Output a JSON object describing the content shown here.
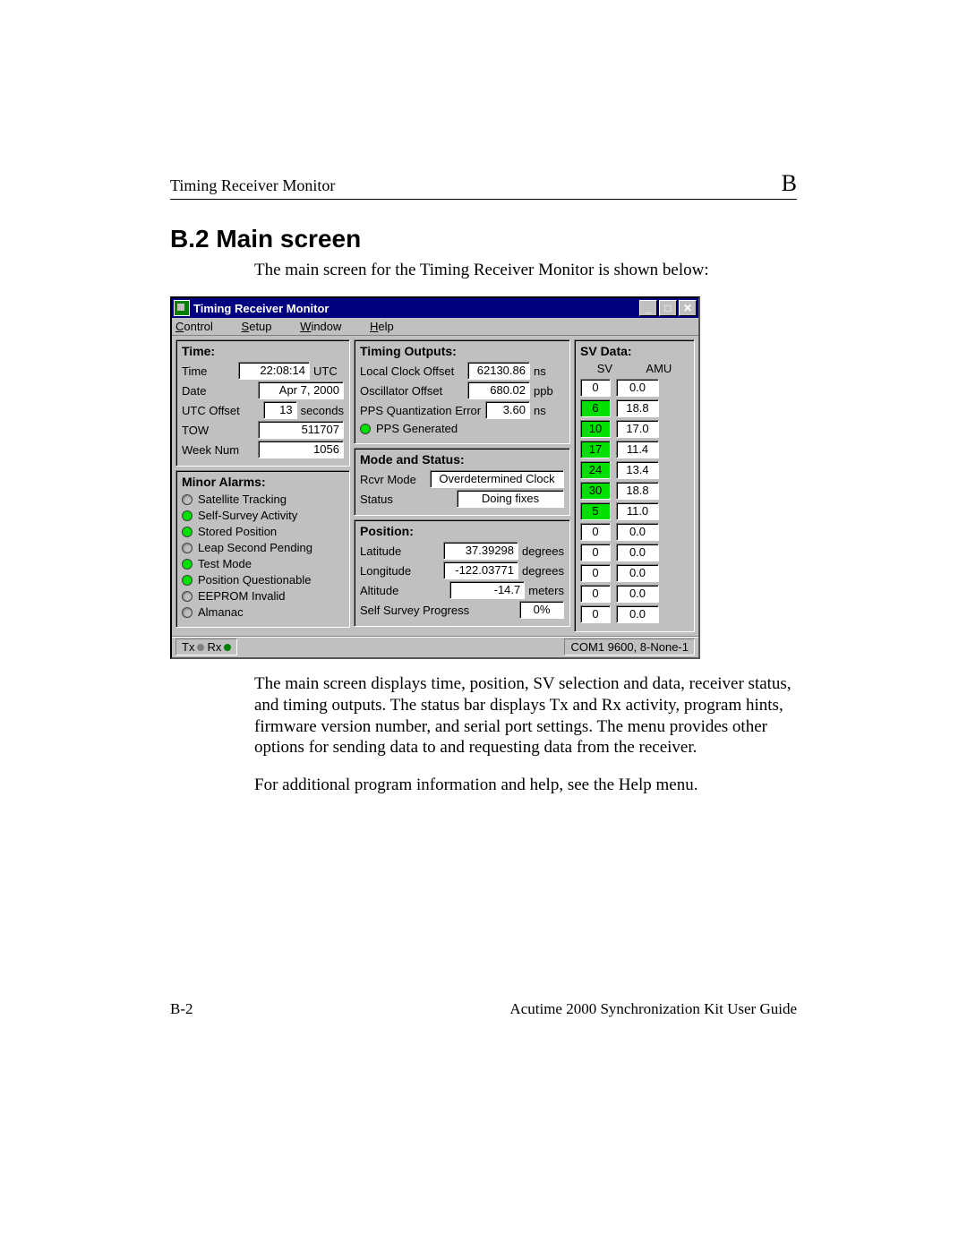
{
  "header": {
    "left": "Timing Receiver Monitor",
    "right": "B"
  },
  "section_title": "B.2    Main screen",
  "intro": "The main screen for the Timing Receiver Monitor is shown below:",
  "window_title": "Timing Receiver Monitor",
  "menus": {
    "m1_u": "C",
    "m1": "ontrol",
    "m2_u": "S",
    "m2": "etup",
    "m3_u": "W",
    "m3": "indow",
    "m4_u": "H",
    "m4": "elp"
  },
  "time_panel": {
    "title": "Time:",
    "rows": {
      "time": {
        "label": "Time",
        "value": "22:08:14",
        "unit": "UTC"
      },
      "date": {
        "label": "Date",
        "value": "Apr 7, 2000",
        "unit": ""
      },
      "utc": {
        "label": "UTC Offset",
        "value": "13",
        "unit": "seconds"
      },
      "tow": {
        "label": "TOW",
        "value": "511707",
        "unit": ""
      },
      "week": {
        "label": "Week Num",
        "value": "1056",
        "unit": ""
      }
    }
  },
  "alarms_panel": {
    "title": "Minor Alarms:",
    "items": [
      {
        "label": "Satellite Tracking",
        "on": false
      },
      {
        "label": "Self-Survey Activity",
        "on": true
      },
      {
        "label": "Stored Position",
        "on": true
      },
      {
        "label": "Leap Second Pending",
        "on": false
      },
      {
        "label": "Test Mode",
        "on": true
      },
      {
        "label": "Position Questionable",
        "on": true
      },
      {
        "label": "EEPROM Invalid",
        "on": false
      },
      {
        "label": "Almanac",
        "on": false
      }
    ]
  },
  "outputs_panel": {
    "title": "Timing Outputs:",
    "rows": {
      "lco": {
        "label": "Local Clock Offset",
        "value": "62130.86",
        "unit": "ns"
      },
      "osc": {
        "label": "Oscillator Offset",
        "value": "680.02",
        "unit": "ppb"
      },
      "pqe": {
        "label": "PPS Quantization Error",
        "value": "3.60",
        "unit": "ns"
      }
    },
    "pps_label": "PPS Generated"
  },
  "mode_panel": {
    "title": "Mode and Status:",
    "rows": {
      "mode": {
        "label": "Rcvr Mode",
        "value": "Overdetermined Clock"
      },
      "status": {
        "label": "Status",
        "value": "Doing fixes"
      }
    }
  },
  "position_panel": {
    "title": "Position:",
    "rows": {
      "lat": {
        "label": "Latitude",
        "value": "37.39298",
        "unit": "degrees"
      },
      "lon": {
        "label": "Longitude",
        "value": "-122.03771",
        "unit": "degrees"
      },
      "alt": {
        "label": "Altitude",
        "value": "-14.7",
        "unit": "meters"
      }
    },
    "survey": {
      "label": "Self Survey Progress",
      "value": "0%"
    }
  },
  "sv_panel": {
    "title": "SV Data:",
    "head_sv": "SV",
    "head_amu": "AMU",
    "rows": [
      {
        "sv": "0",
        "amu": "0.0",
        "active": false
      },
      {
        "sv": "6",
        "amu": "18.8",
        "active": true
      },
      {
        "sv": "10",
        "amu": "17.0",
        "active": true
      },
      {
        "sv": "17",
        "amu": "11.4",
        "active": true
      },
      {
        "sv": "24",
        "amu": "13.4",
        "active": true
      },
      {
        "sv": "30",
        "amu": "18.8",
        "active": true
      },
      {
        "sv": "5",
        "amu": "11.0",
        "active": true
      },
      {
        "sv": "0",
        "amu": "0.0",
        "active": false
      },
      {
        "sv": "0",
        "amu": "0.0",
        "active": false
      },
      {
        "sv": "0",
        "amu": "0.0",
        "active": false
      },
      {
        "sv": "0",
        "amu": "0.0",
        "active": false
      },
      {
        "sv": "0",
        "amu": "0.0",
        "active": false
      }
    ]
  },
  "statusbar": {
    "tx": "Tx",
    "rx": "Rx",
    "port": "COM1 9600, 8-None-1"
  },
  "para1": "The main screen displays time, position, SV selection and data, receiver status, and timing outputs. The status bar displays Tx and Rx activity, program hints, firmware version number, and serial port settings. The menu provides other options for sending data to and requesting data from the receiver.",
  "para2": "For additional program information and help, see the Help menu.",
  "footer": {
    "left": "B-2",
    "right": "Acutime 2000 Synchronization Kit User Guide"
  }
}
